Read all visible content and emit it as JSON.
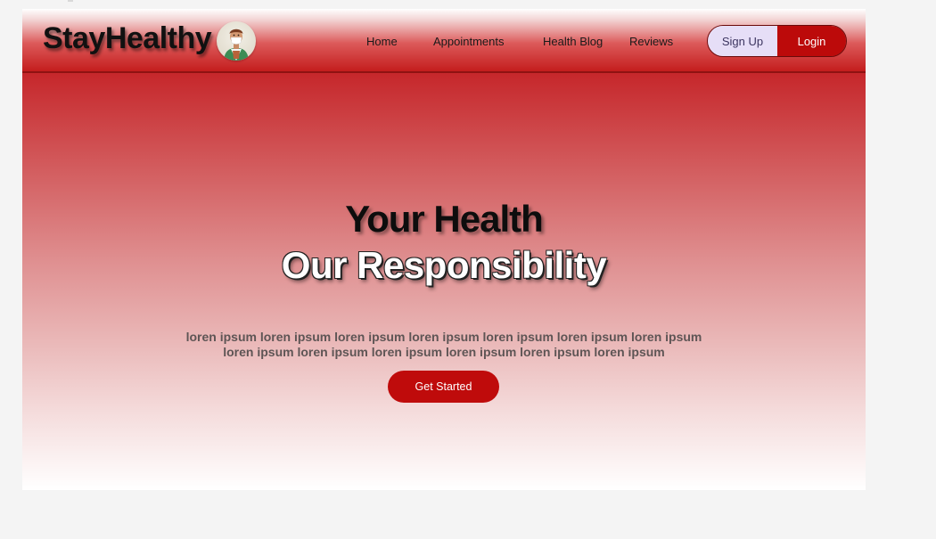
{
  "header": {
    "brand": "StayHealthy",
    "avatar_icon": "doctor-avatar-icon",
    "nav": [
      {
        "label": "Home"
      },
      {
        "label": "Appointments"
      },
      {
        "label": "Health Blog"
      },
      {
        "label": "Reviews"
      }
    ],
    "signup_label": "Sign Up",
    "login_label": "Login"
  },
  "hero": {
    "line1": "Your Health",
    "line2": "Our Responsibility",
    "description": [
      "loren ipsum loren ipsum loren ipsum loren ipsum loren ipsum loren ipsum loren ipsum",
      "loren ipsum loren ipsum loren ipsum loren ipsum loren ipsum loren ipsum"
    ],
    "cta_label": "Get Started"
  },
  "colors": {
    "accent": "#bc0a0a",
    "signup_bg": "#e6def7",
    "page_bg": "#f4f4f4"
  }
}
